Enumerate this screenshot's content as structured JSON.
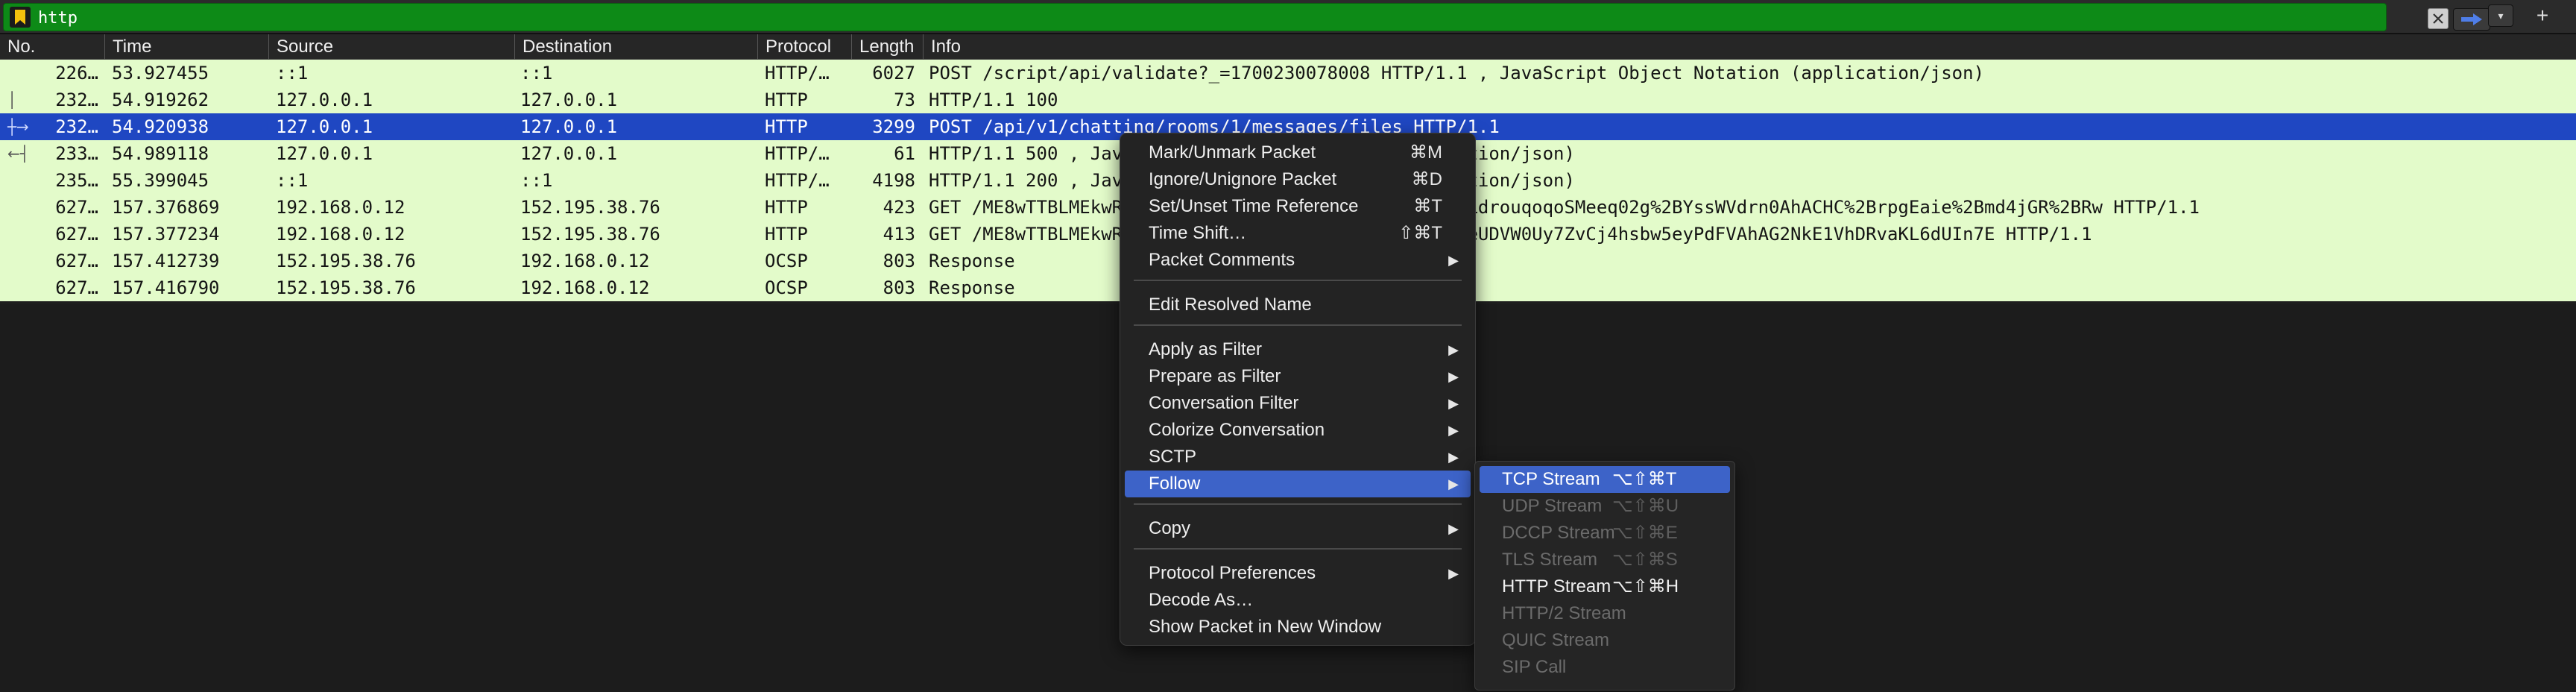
{
  "filter": {
    "value": "http",
    "bookmark_icon": "bookmark-icon",
    "clear_icon": "clear-icon",
    "apply_icon": "arrow-right-icon",
    "dropdown_icon": "chevron-down-icon",
    "add_label": "+"
  },
  "columns": [
    "No.",
    "Time",
    "Source",
    "Destination",
    "Protocol",
    "Length",
    "Info"
  ],
  "packets": [
    {
      "no": "226…",
      "time": "53.927455",
      "source": "::1",
      "destination": "::1",
      "protocol": "HTTP/…",
      "length": "6027",
      "info": "POST /script/api/validate?_=1700230078008 HTTP/1.1 , JavaScript Object Notation (application/json)",
      "marker": ""
    },
    {
      "no": "232…",
      "time": "54.919262",
      "source": "127.0.0.1",
      "destination": "127.0.0.1",
      "protocol": "HTTP",
      "length": "73",
      "info": "HTTP/1.1 100",
      "marker": "│"
    },
    {
      "no": "232…",
      "time": "54.920938",
      "source": "127.0.0.1",
      "destination": "127.0.0.1",
      "protocol": "HTTP",
      "length": "3299",
      "info": "POST /api/v1/chatting/rooms/1/messages/files HTTP/1.1",
      "marker": "┼→"
    },
    {
      "no": "233…",
      "time": "54.989118",
      "source": "127.0.0.1",
      "destination": "127.0.0.1",
      "protocol": "HTTP/…",
      "length": "61",
      "info": "HTTP/1.1 500  , JavaScript Object Notation (application/json)",
      "marker": "←┤"
    },
    {
      "no": "235…",
      "time": "55.399045",
      "source": "::1",
      "destination": "::1",
      "protocol": "HTTP/…",
      "length": "4198",
      "info": "HTTP/1.1 200  , JavaScript Object Notation (application/json)",
      "marker": ""
    },
    {
      "no": "627…",
      "time": "157.376869",
      "source": "192.168.0.12",
      "destination": "152.195.38.76",
      "protocol": "HTTP",
      "length": "423",
      "info": "GET /ME8wTTBLMEkwRzAHBgUrDgMCGgQU2FCYDAtOwAmKq9gEFLdrouqoqoSMeeq02g%2BYssWVdrn0AhACHC%2BrpgEaie%2Bmd4jGR%2BRw HTTP/1.1",
      "marker": ""
    },
    {
      "no": "627…",
      "time": "157.377234",
      "source": "192.168.0.12",
      "destination": "152.195.38.76",
      "protocol": "HTTP",
      "length": "413",
      "info": "GET /ME8wTTBLMEkwRzAHBgUrDgMCGgQUeg6If7AWIBVe4EFAPeUDVW0Uy7ZvCj4hsbw5eyPdFVAhAG2NkE1VhDRvaKL6dUIn7E HTTP/1.1",
      "marker": ""
    },
    {
      "no": "627…",
      "time": "157.412739",
      "source": "152.195.38.76",
      "destination": "192.168.0.12",
      "protocol": "OCSP",
      "length": "803",
      "info": "Response",
      "marker": ""
    },
    {
      "no": "627…",
      "time": "157.416790",
      "source": "152.195.38.76",
      "destination": "192.168.0.12",
      "protocol": "OCSP",
      "length": "803",
      "info": "Response",
      "marker": ""
    }
  ],
  "selected_row": 2,
  "context_menu": {
    "items": [
      {
        "label": "Mark/Unmark Packet",
        "shortcut": "⌘M"
      },
      {
        "label": "Ignore/Unignore Packet",
        "shortcut": "⌘D"
      },
      {
        "label": "Set/Unset Time Reference",
        "shortcut": "⌘T"
      },
      {
        "label": "Time Shift…",
        "shortcut": "⇧⌘T"
      },
      {
        "label": "Packet Comments",
        "submenu": true
      },
      {
        "label": "Edit Resolved Name"
      },
      {
        "label": "Apply as Filter",
        "submenu": true
      },
      {
        "label": "Prepare as Filter",
        "submenu": true
      },
      {
        "label": "Conversation Filter",
        "submenu": true
      },
      {
        "label": "Colorize Conversation",
        "submenu": true
      },
      {
        "label": "SCTP",
        "submenu": true
      },
      {
        "label": "Follow",
        "submenu": true,
        "active": true
      },
      {
        "label": "Copy",
        "submenu": true
      },
      {
        "label": "Protocol Preferences",
        "submenu": true
      },
      {
        "label": "Decode As…"
      },
      {
        "label": "Show Packet in New Window"
      }
    ],
    "submenu_arrow": "▶"
  },
  "follow_submenu": {
    "items": [
      {
        "label": "TCP Stream",
        "shortcut": "⌥⇧⌘T",
        "state": "active"
      },
      {
        "label": "UDP Stream",
        "shortcut": "⌥⇧⌘U",
        "state": "disabled"
      },
      {
        "label": "DCCP Stream",
        "shortcut": "⌥⇧⌘E",
        "state": "disabled"
      },
      {
        "label": "TLS Stream",
        "shortcut": "⌥⇧⌘S",
        "state": "disabled"
      },
      {
        "label": "HTTP Stream",
        "shortcut": "⌥⇧⌘H",
        "state": "enabled"
      },
      {
        "label": "HTTP/2 Stream",
        "shortcut": "",
        "state": "disabled"
      },
      {
        "label": "QUIC Stream",
        "shortcut": "",
        "state": "disabled"
      },
      {
        "label": "SIP Call",
        "shortcut": "",
        "state": "disabled"
      }
    ]
  },
  "colors": {
    "filter_valid": "#0d8a17",
    "row_http": "#e3fbca",
    "row_selected": "#1f47c2",
    "menu_highlight": "#3d63c8"
  }
}
